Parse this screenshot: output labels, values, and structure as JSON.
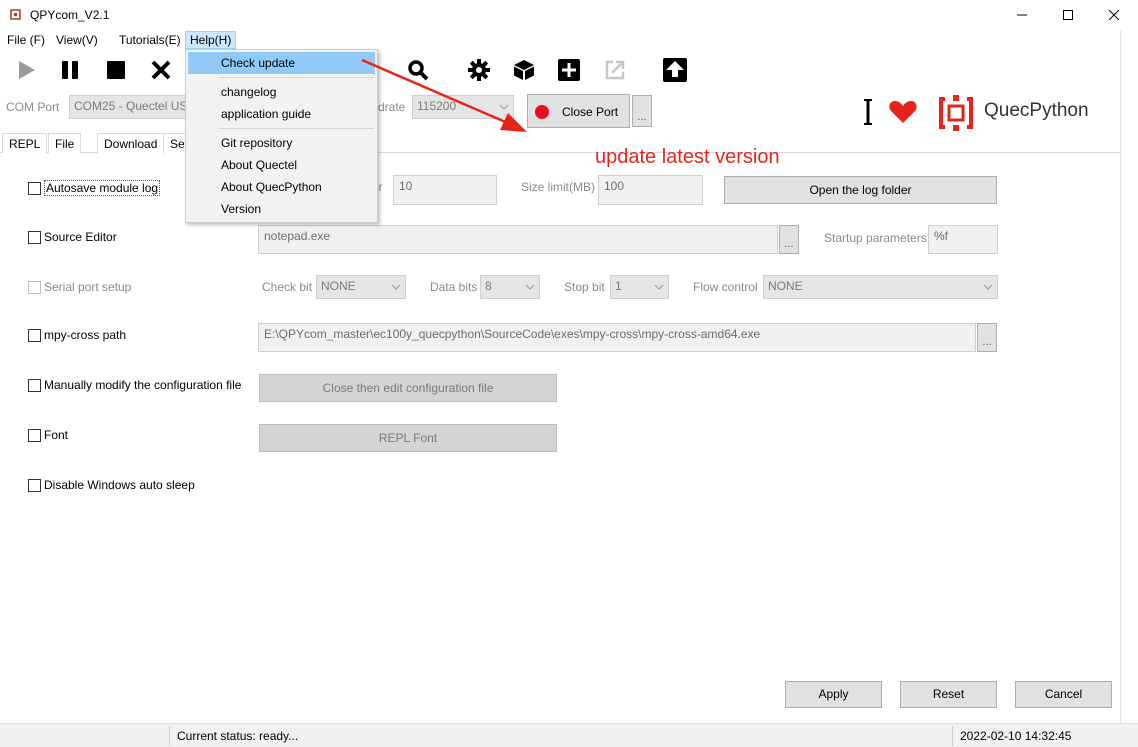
{
  "window": {
    "title": "QPYcom_V2.1"
  },
  "menu": {
    "file": "File (F)",
    "view": "View(V)",
    "tutorials": "Tutorials(E)",
    "help": "Help(H)"
  },
  "toolbar": {
    "buttons": [
      "play-icon",
      "pause-icon",
      "stop-icon",
      "close-icon",
      "search-icon",
      "gear-icon",
      "cube-icon",
      "plus-icon",
      "share-icon",
      "upload-icon"
    ]
  },
  "port": {
    "com_label": "COM Port",
    "com_value": "COM25 - Quectel US",
    "baud_label": "drate",
    "baud_value": "115200",
    "close_port": "Close Port",
    "more": "..."
  },
  "logo": {
    "text": "QuecPython",
    "accent": "#e8241a"
  },
  "tabs": [
    "REPL",
    "File",
    "Download",
    "Set"
  ],
  "settings": {
    "autosave": {
      "label": "Autosave module log",
      "number_label": "er",
      "number_value": "10",
      "size_label": "Size limit(MB)",
      "size_value": "100",
      "open_folder": "Open the log folder"
    },
    "source_editor": {
      "label": "Source Editor",
      "value": "notepad.exe",
      "more": "...",
      "params_label": "Startup parameters",
      "params_value": "%f"
    },
    "serial": {
      "label": "Serial port setup",
      "check_bit_label": "Check bit",
      "check_bit": "NONE",
      "data_bits_label": "Data bits",
      "data_bits": "8",
      "stop_bit_label": "Stop bit",
      "stop_bit": "1",
      "flow_label": "Flow control",
      "flow": "NONE"
    },
    "mpy": {
      "label": "mpy-cross path",
      "value": "E:\\QPYcom_master\\ec100y_quecpython\\SourceCode\\exes\\mpy-cross\\mpy-cross-amd64.exe",
      "more": "..."
    },
    "config": {
      "label": "Manually modify the configuration file",
      "button": "Close then edit configuration file"
    },
    "font": {
      "label": "Font",
      "button": "REPL Font"
    },
    "sleep": {
      "label": "Disable Windows auto sleep"
    }
  },
  "actions": {
    "apply": "Apply",
    "reset": "Reset",
    "cancel": "Cancel"
  },
  "help_menu": {
    "check_update": "Check update",
    "changelog": "changelog",
    "guide": "application guide",
    "git": "Git repository",
    "about_quectel": "About Quectel",
    "about_quecpython": "About QuecPython",
    "version": "Version"
  },
  "annotation": {
    "text": "update latest version",
    "color": "#e8241a"
  },
  "status": {
    "text": "Current status: ready...",
    "time": "2022-02-10 14:32:45"
  }
}
